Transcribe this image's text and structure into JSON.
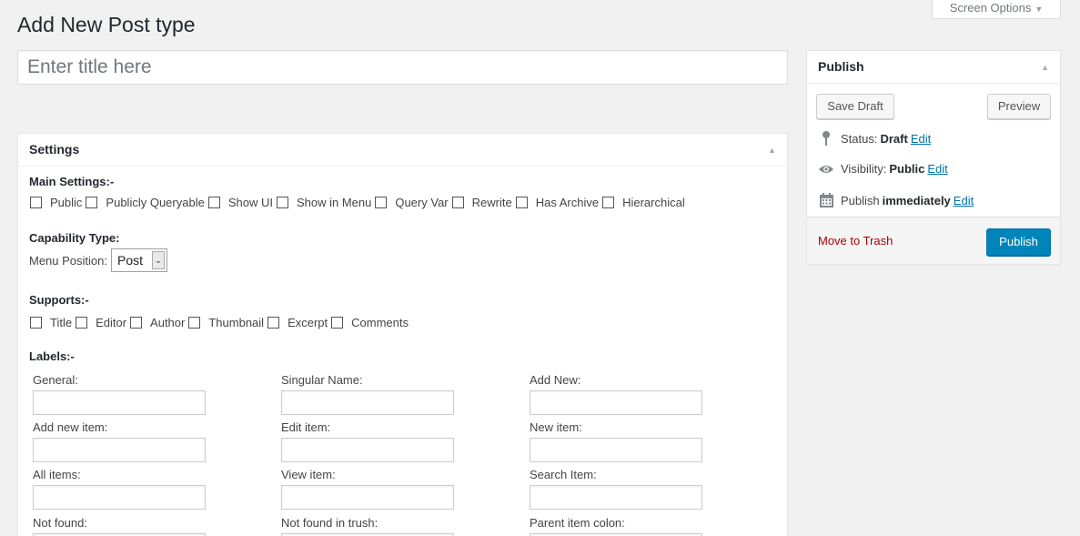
{
  "screen_options": {
    "label": "Screen Options",
    "arrow": "▼"
  },
  "page_title": "Add New Post type",
  "title_input": {
    "placeholder": "Enter title here",
    "value": ""
  },
  "settings": {
    "title": "Settings",
    "toggle": "▲",
    "main_settings": {
      "heading": "Main Settings:-",
      "options": [
        "Public",
        "Publicly Queryable",
        "Show UI",
        "Show in Menu",
        "Query Var",
        "Rewrite",
        "Has Archive",
        "Hierarchical"
      ]
    },
    "capability": {
      "heading": "Capability Type:",
      "menu_position_label": "Menu Position:",
      "menu_position_value": "Post",
      "caret": "⌄"
    },
    "supports": {
      "heading": "Supports:-",
      "options": [
        "Title",
        "Editor",
        "Author",
        "Thumbnail",
        "Excerpt",
        "Comments"
      ]
    },
    "labels": {
      "heading": "Labels:-",
      "fields": [
        "General:",
        "Singular Name:",
        "Add New:",
        "Add new item:",
        "Edit item:",
        "New item:",
        "All items:",
        "View item:",
        "Search Item:",
        "Not found:",
        "Not found in trush:",
        "Parent item colon:"
      ]
    }
  },
  "publish": {
    "title": "Publish",
    "toggle": "▲",
    "save_draft": "Save Draft",
    "preview": "Preview",
    "status_label": "Status:",
    "status_value": "Draft",
    "visibility_label": "Visibility:",
    "visibility_value": "Public",
    "publish_label": "Publish",
    "publish_value": "immediately",
    "edit": "Edit",
    "move_to_trash": "Move to Trash",
    "publish_button": "Publish"
  }
}
